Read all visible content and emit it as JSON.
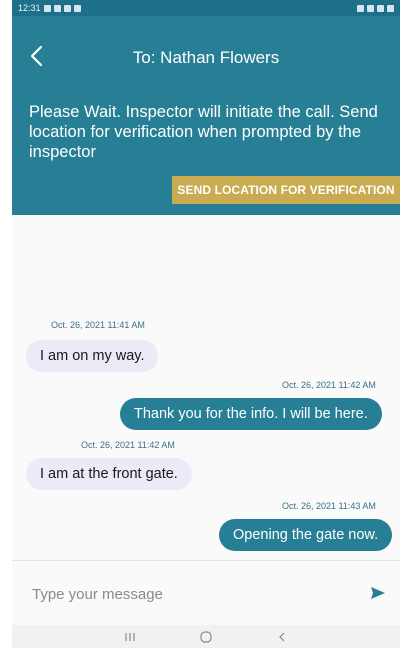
{
  "status_bar": {
    "time": "12:31"
  },
  "header": {
    "title": "To: Nathan Flowers",
    "notice": "Please Wait. Inspector will initiate the call. Send location for verification when prompted by the inspector",
    "verify_button": "SEND LOCATION FOR VERIFICATION"
  },
  "messages": [
    {
      "direction": "in",
      "timestamp": "Oct. 26, 2021  11:41 AM",
      "text": "I am on my way."
    },
    {
      "direction": "out",
      "timestamp": "Oct. 26, 2021  11:42 AM",
      "text": "Thank you for the info. I will be here."
    },
    {
      "direction": "in",
      "timestamp": "Oct. 26, 2021  11:42 AM",
      "text": "I am at the front gate."
    },
    {
      "direction": "out",
      "timestamp": "Oct. 26, 2021  11:43 AM",
      "text": "Opening the gate now."
    }
  ],
  "composer": {
    "placeholder": "Type your message"
  },
  "colors": {
    "primary": "#267f95",
    "accent": "#c9ab52",
    "incoming_bubble": "#eceaf6"
  },
  "icons": {
    "back": "chevron-left-icon",
    "send": "send-icon",
    "nav_recents": "recents-icon",
    "nav_home": "home-icon",
    "nav_back": "nav-back-icon"
  }
}
